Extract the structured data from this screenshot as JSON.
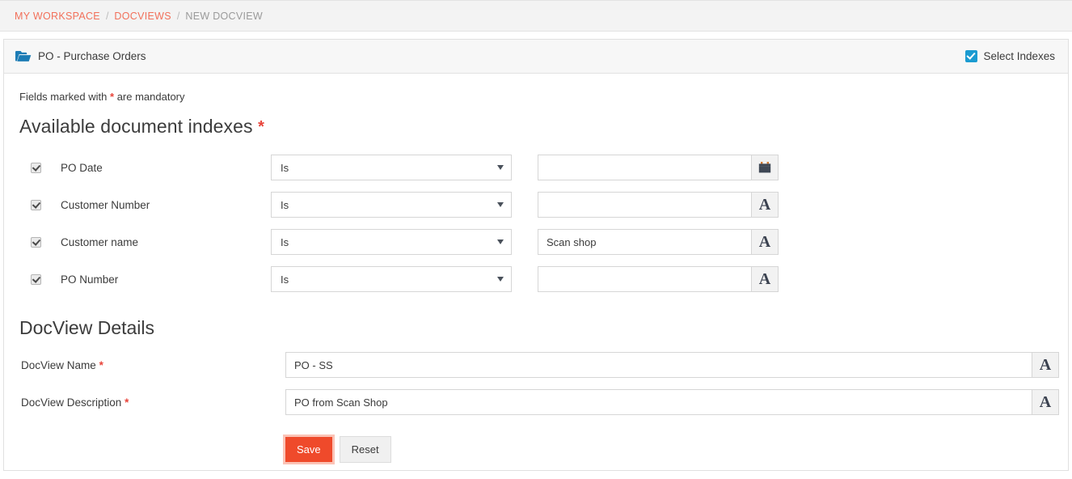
{
  "breadcrumb": {
    "items": [
      {
        "label": "MY WORKSPACE",
        "current": false
      },
      {
        "label": "DOCVIEWS",
        "current": false
      },
      {
        "label": "NEW DOCVIEW",
        "current": true
      }
    ],
    "separator": "/"
  },
  "panel": {
    "folder_icon": "folder-open-icon",
    "title": "PO - Purchase Orders",
    "select_indexes": {
      "label": "Select Indexes",
      "checked": true,
      "icon": "checkbox-checked-icon"
    }
  },
  "form": {
    "mandatory_note_prefix": "Fields marked with",
    "mandatory_marker": "*",
    "mandatory_note_suffix": "are mandatory",
    "section_title": "Available document indexes",
    "section_required_marker": "*",
    "indexes": [
      {
        "checked": true,
        "label": "PO Date",
        "operator": "Is",
        "value": "",
        "addon_icon": "calendar-icon",
        "addon_text": ""
      },
      {
        "checked": true,
        "label": "Customer Number",
        "operator": "Is",
        "value": "",
        "addon_icon": "text-field-icon",
        "addon_text": "A"
      },
      {
        "checked": true,
        "label": "Customer name",
        "operator": "Is",
        "value": "Scan shop",
        "addon_icon": "text-field-icon",
        "addon_text": "A"
      },
      {
        "checked": true,
        "label": "PO Number",
        "operator": "Is",
        "value": "",
        "addon_icon": "text-field-icon",
        "addon_text": "A"
      }
    ]
  },
  "details": {
    "title": "DocView Details",
    "name_label": "DocView Name",
    "name_required_marker": "*",
    "name_value": "PO - SS",
    "name_addon_text": "A",
    "description_label": "DocView Description",
    "description_required_marker": "*",
    "description_value": "PO from Scan Shop",
    "description_addon_text": "A"
  },
  "actions": {
    "save_label": "Save",
    "reset_label": "Reset"
  },
  "colors": {
    "breadcrumb_link": "#f2705a",
    "breadcrumb_current": "#9a9a9a",
    "required_marker": "#e8443a",
    "select_indexes_checkbox": "#1b9bd1",
    "folder_icon": "#1c7cb5",
    "save_button": "#ef4a2b",
    "save_focus_ring": "#fbc3b6"
  }
}
